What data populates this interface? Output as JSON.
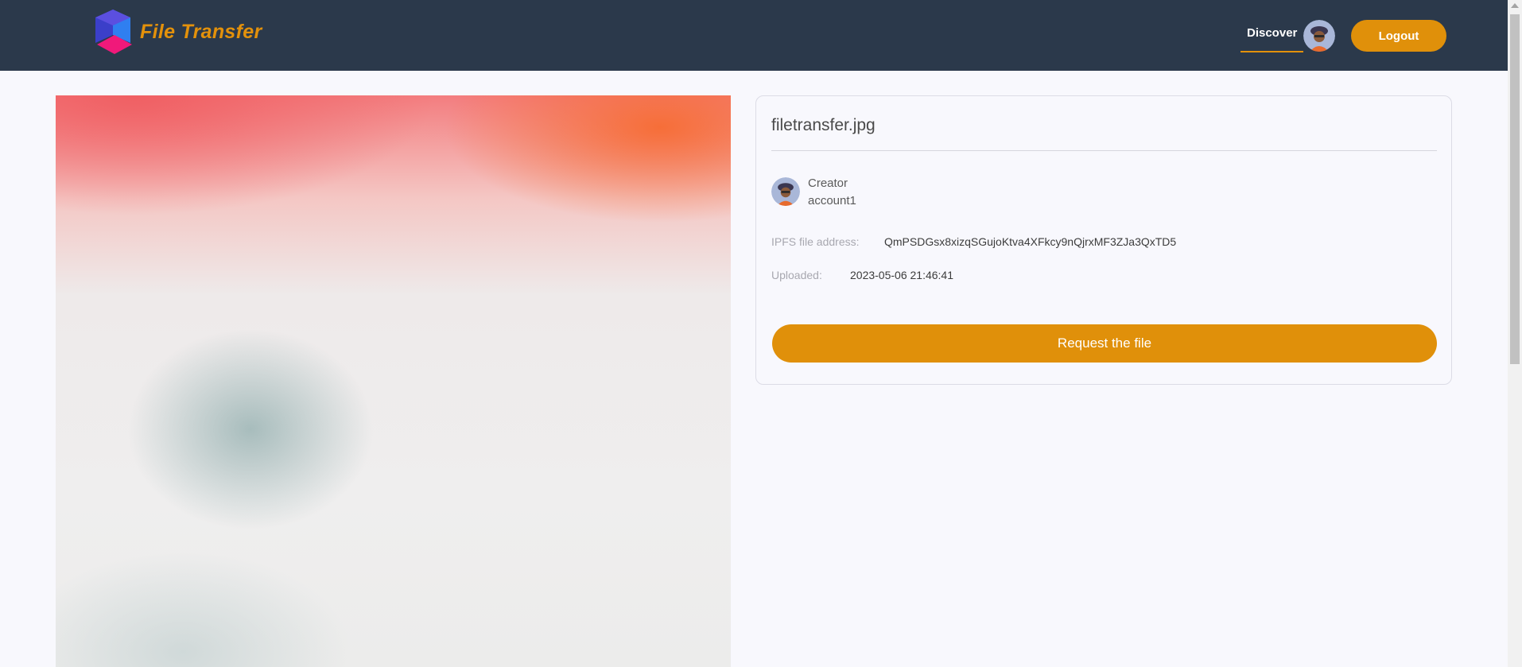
{
  "brand": {
    "name": "File Transfer",
    "accent_color": "#e3910b"
  },
  "nav": {
    "discover_label": "Discover",
    "logout_label": "Logout",
    "avatar_icon": "user-avatar-icon"
  },
  "file": {
    "name": "filetransfer.jpg",
    "creator_label": "Creator",
    "creator_name": "account1",
    "ipfs_label": "IPFS file address:",
    "ipfs_value": "QmPSDGsx8xizqSGujoKtva4XFkcy9nQjrxMF3ZJa3QxTD5",
    "uploaded_label": "Uploaded:",
    "uploaded_value": "2023-05-06 21:46:41",
    "request_label": "Request the file"
  },
  "colors": {
    "topbar": "#2b394b",
    "button": "#e0900a",
    "background": "#f8f8fd"
  }
}
